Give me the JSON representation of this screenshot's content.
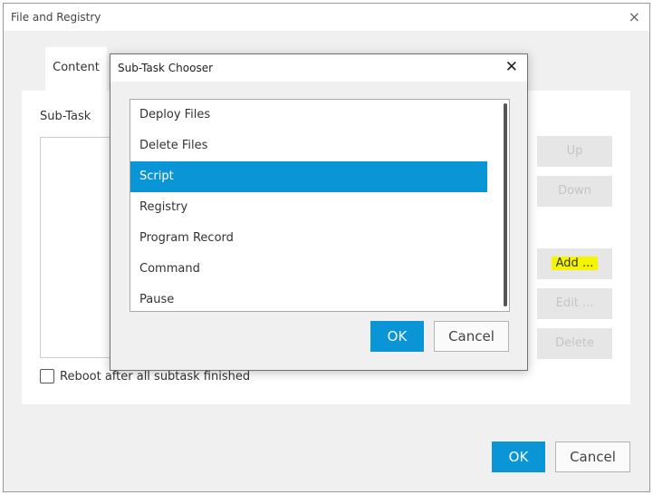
{
  "window": {
    "title": "File and Registry",
    "close_icon": "×"
  },
  "tabs": [
    {
      "label": "Content"
    }
  ],
  "subtask": {
    "label": "Sub-Task"
  },
  "side_buttons": {
    "up": "Up",
    "down": "Down",
    "add": "Add ...",
    "edit": "Edit ...",
    "delete": "Delete"
  },
  "reboot_checkbox": {
    "label": "Reboot after all subtask finished",
    "checked": false
  },
  "footer": {
    "ok": "OK",
    "cancel": "Cancel"
  },
  "chooser": {
    "title": "Sub-Task Chooser",
    "close_icon": "✕",
    "items": [
      {
        "label": "Deploy Files"
      },
      {
        "label": "Delete Files"
      },
      {
        "label": "Script",
        "selected": true
      },
      {
        "label": "Registry"
      },
      {
        "label": "Program Record"
      },
      {
        "label": "Command"
      },
      {
        "label": "Pause"
      }
    ],
    "ok": "OK",
    "cancel": "Cancel"
  },
  "colors": {
    "accent": "#0a96d6",
    "highlight": "#f6f500"
  }
}
